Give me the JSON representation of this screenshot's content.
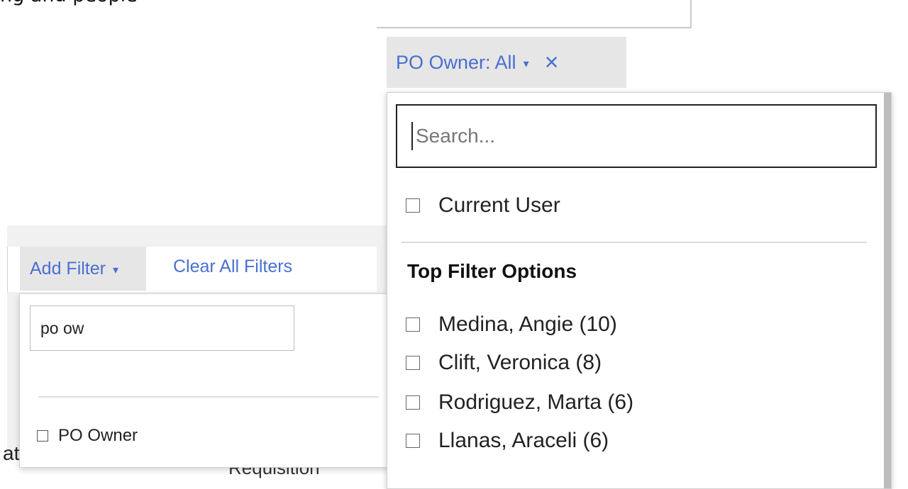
{
  "background_partial": {
    "top_text": "ng and people",
    "left_clipped": "at",
    "clipped_column": "Requisition",
    "clipped_paren": "("
  },
  "po_owner_filter": {
    "chip_label": "PO Owner: All",
    "caret": "▾",
    "close_icon": "×",
    "search": {
      "placeholder": "Search...",
      "value": ""
    },
    "current_user_label": "Current User",
    "top_options_heading": "Top Filter Options",
    "options": [
      {
        "label": "Medina, Angie (10)"
      },
      {
        "label": "Clift, Veronica (8)"
      },
      {
        "label": "Rodriguez, Marta (6)"
      },
      {
        "label": "Llanas, Araceli (6)"
      }
    ]
  },
  "add_filter": {
    "label": "Add Filter",
    "caret": "▾",
    "clear_all_label": "Clear All Filters",
    "search_value": "po ow",
    "results": [
      {
        "label": "PO Owner"
      }
    ]
  },
  "colors": {
    "link": "#4a6fd1",
    "chip_bg": "#e6e6e6"
  }
}
